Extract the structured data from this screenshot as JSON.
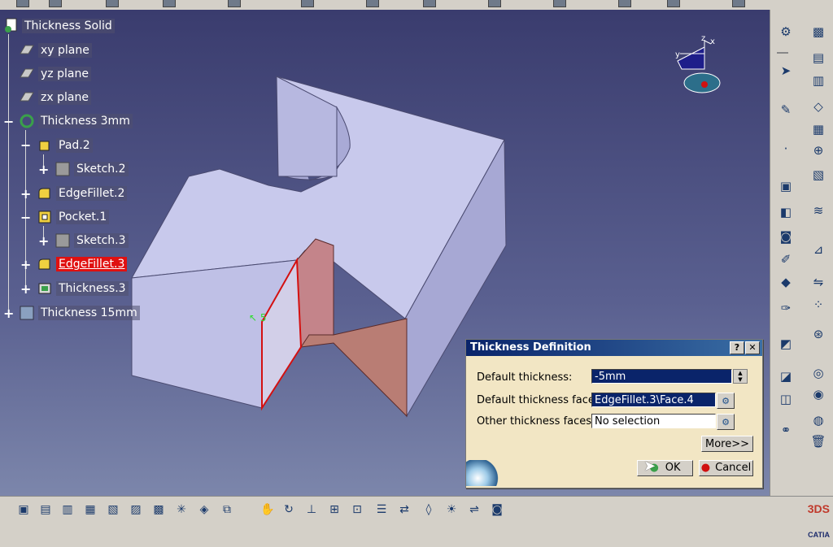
{
  "tree": {
    "root": "Thickness Solid",
    "items": [
      {
        "label": "xy plane"
      },
      {
        "label": "yz plane"
      },
      {
        "label": "zx plane"
      },
      {
        "label": "Thickness 3mm"
      },
      {
        "label": "Pad.2"
      },
      {
        "label": "Sketch.2"
      },
      {
        "label": "EdgeFillet.2"
      },
      {
        "label": "Pocket.1"
      },
      {
        "label": "Sketch.3"
      },
      {
        "label": "EdgeFillet.3",
        "selected": true
      },
      {
        "label": "Thickness.3"
      },
      {
        "label": "Thickness 15mm"
      }
    ]
  },
  "compass": {
    "x": "x",
    "y": "y",
    "z": "z"
  },
  "annotation": {
    "value": "5"
  },
  "dialog": {
    "title": "Thickness Definition",
    "help_label": "?",
    "close_label": "✕",
    "default_thickness_label": "Default thickness:",
    "default_thickness_value": "-5mm",
    "default_faces_label": "Default thickness faces:",
    "default_faces_value": "EdgeFillet.3\\Face.4",
    "other_faces_label": "Other thickness faces:",
    "other_faces_value": "No selection",
    "more_label": "More>>",
    "ok_label": "OK",
    "cancel_label": "Cancel"
  },
  "brand": {
    "name": "CATIA"
  },
  "colors": {
    "part_face": "#c8c9ec",
    "part_side": "#a7a8d4",
    "selected_face": "#b97d74",
    "selected_edge": "#d41010",
    "dialog_bg": "#f2e6c4",
    "title_bar": "#0a246a"
  }
}
